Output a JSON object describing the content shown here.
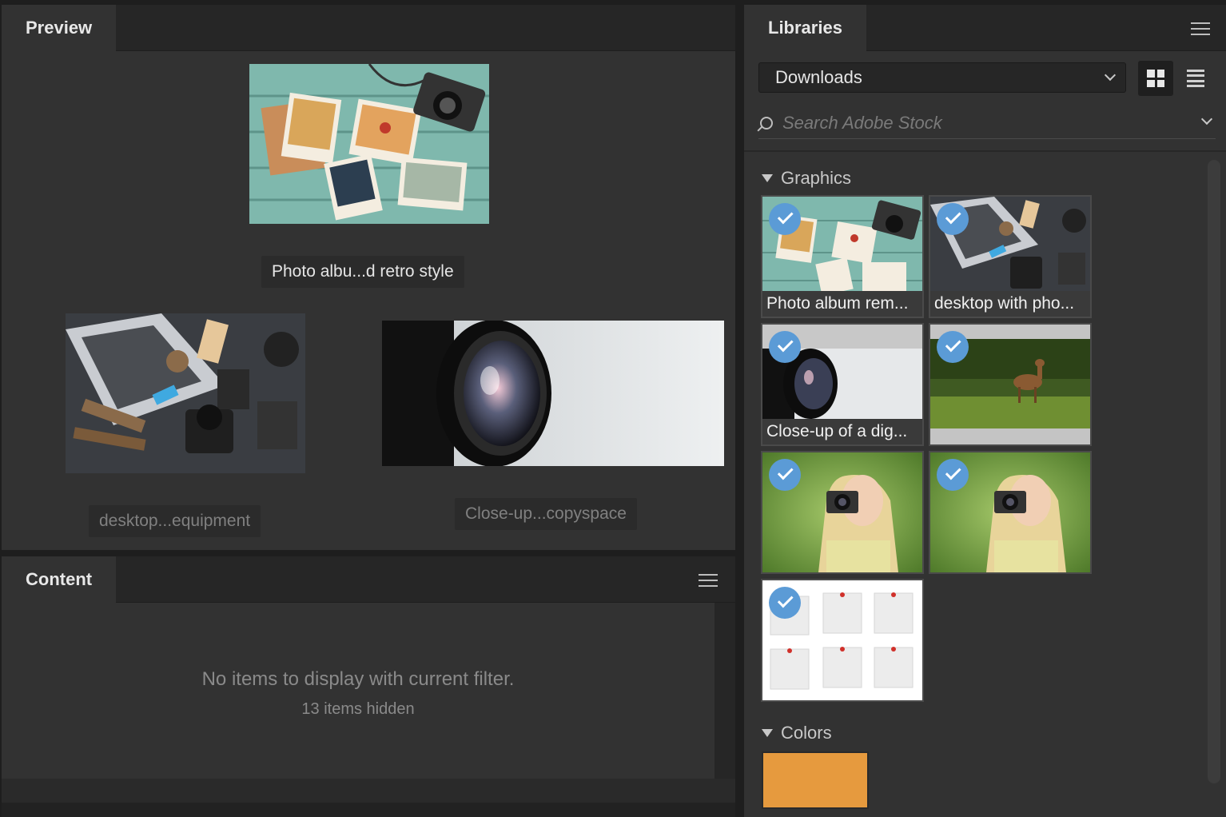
{
  "preview": {
    "tab_label": "Preview",
    "items": [
      {
        "caption": "Photo albu...d retro style",
        "selected": true
      },
      {
        "caption": "desktop...equipment",
        "selected": false
      },
      {
        "caption": "Close-up...copyspace",
        "selected": false
      }
    ]
  },
  "content": {
    "tab_label": "Content",
    "empty_message": "No items to display with current filter.",
    "hidden_count": "13 items hidden"
  },
  "libraries": {
    "tab_label": "Libraries",
    "library_select": "Downloads",
    "search_placeholder": "Search Adobe Stock",
    "graphics_heading": "Graphics",
    "colors_heading": "Colors",
    "graphics": [
      {
        "label": "Photo album rem...",
        "icon": "photo-album-thumb"
      },
      {
        "label": "desktop with pho...",
        "icon": "desktop-equipment-thumb"
      },
      {
        "label": "Close-up of a dig...",
        "icon": "camera-lens-thumb"
      },
      {
        "label": "",
        "icon": "deer-thumb"
      },
      {
        "label": "",
        "icon": "woman-camera-thumb"
      },
      {
        "label": "",
        "icon": "woman-camera-thumb"
      },
      {
        "label": "",
        "icon": "sticky-notes-thumb"
      }
    ],
    "colors": [
      "#E69A3E"
    ]
  }
}
